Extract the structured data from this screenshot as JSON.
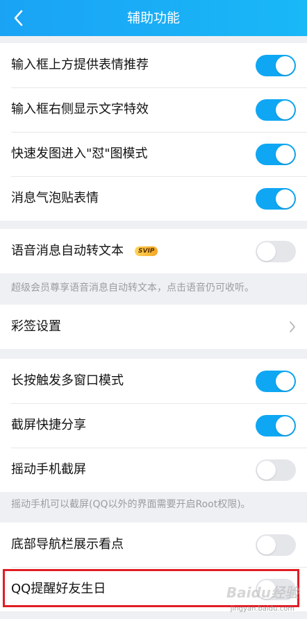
{
  "header": {
    "title": "辅助功能",
    "back_icon": "chevron-left-icon"
  },
  "group1": [
    {
      "label": "输入框上方提供表情推荐",
      "on": true
    },
    {
      "label": "输入框右侧显示文字特效",
      "on": true
    },
    {
      "label": "快速发图进入\"怼\"图模式",
      "on": true
    },
    {
      "label": "消息气泡贴表情",
      "on": true
    }
  ],
  "voice": {
    "label": "语音消息自动转文本",
    "badge": "SVIP",
    "on": false,
    "hint": "超级会员尊享语音消息自动转文本，点击语音仍可收听。"
  },
  "color_sign": {
    "label": "彩签设置"
  },
  "group3": [
    {
      "label": "长按触发多窗口模式",
      "on": true
    },
    {
      "label": "截屏快捷分享",
      "on": true
    },
    {
      "label": "摇动手机截屏",
      "on": false
    }
  ],
  "shake_hint": "摇动手机可以截屏(QQ以外的界面需要开启Root权限)。",
  "group4": [
    {
      "label": "底部导航栏展示看点",
      "on": false
    },
    {
      "label": "QQ提醒好友生日",
      "on": false
    }
  ],
  "watermark": {
    "main": "Baidu经验",
    "sub": "jingyan.baidu.com"
  },
  "colors": {
    "accent": "#0fa7f3",
    "header": "#1aa3f5",
    "highlight": "#e21b23"
  }
}
